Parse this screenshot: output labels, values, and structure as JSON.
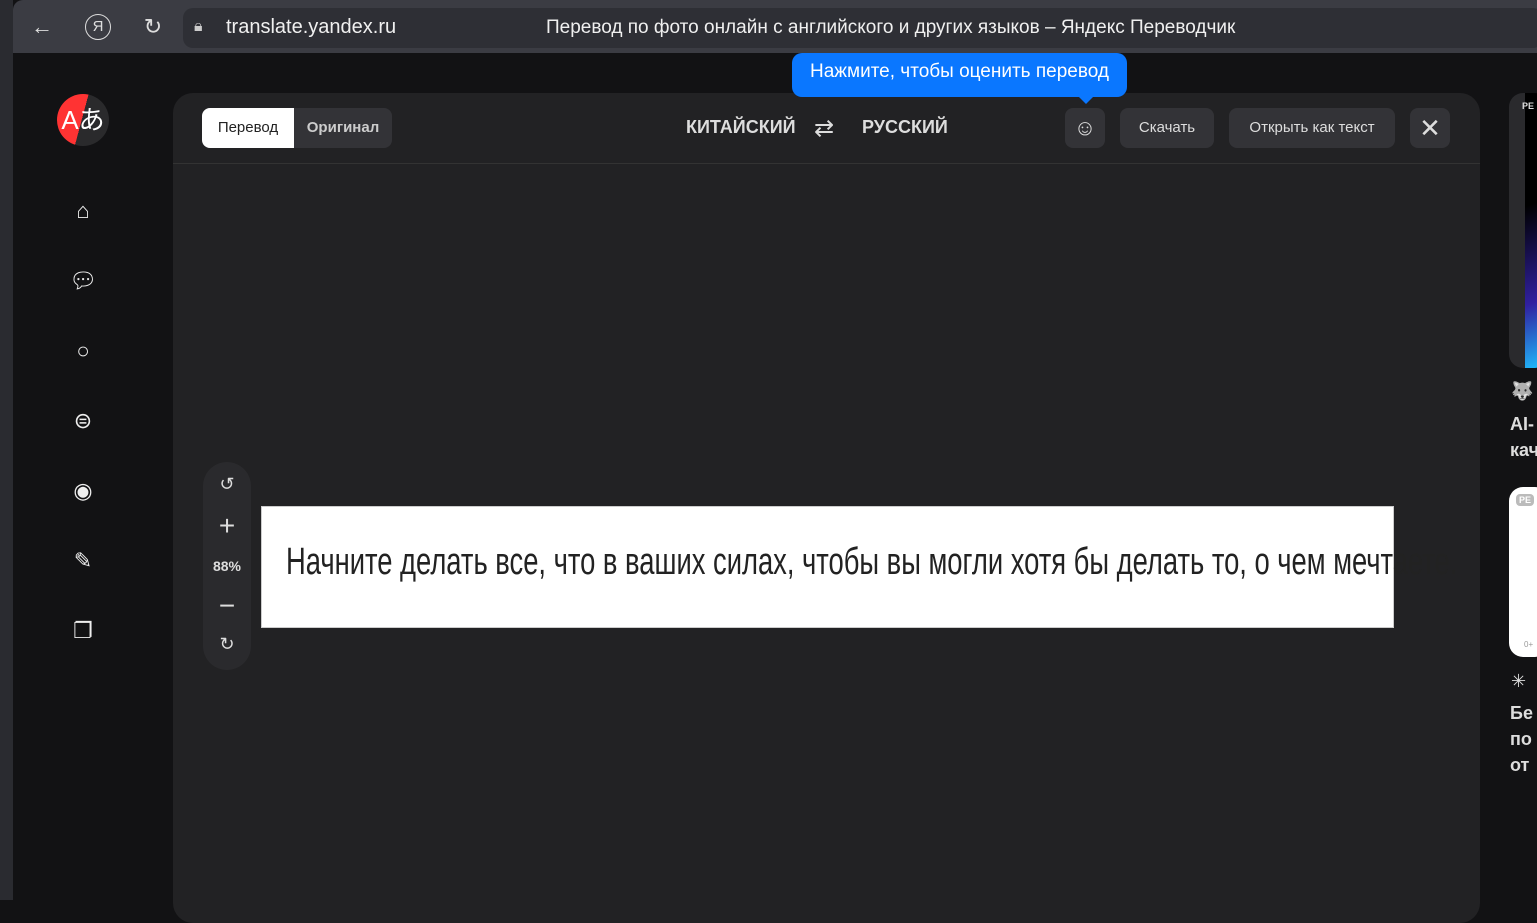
{
  "browser": {
    "url": "translate.yandex.ru",
    "title": "Перевод по фото онлайн с английского и других языков – Яндекс Переводчик"
  },
  "sidebar": {
    "items": [
      "home",
      "chat",
      "dialog",
      "text",
      "camera",
      "edit",
      "bookmarks"
    ]
  },
  "toolbar": {
    "mode_translation": "Перевод",
    "mode_original": "Оригинал",
    "source_lang": "КИТАЙСКИЙ",
    "target_lang": "РУССКИЙ",
    "download": "Скачать",
    "open_as_text": "Открыть как текст"
  },
  "tooltip": "Нажмите, чтобы оценить перевод",
  "zoom": {
    "level": "88%"
  },
  "image": {
    "translated_text": "Начните делать все, что в ваших силах, чтобы вы могли хотя бы делать то, о чем мечтаете."
  },
  "ads": {
    "badge1": "РЕ",
    "text1": "AI-\nкач",
    "badge2": "РЕ",
    "age": "0+",
    "text2": "Бе\nпо\nот"
  },
  "colors": {
    "accent": "#0a77ff",
    "logo": "#ff3333"
  }
}
